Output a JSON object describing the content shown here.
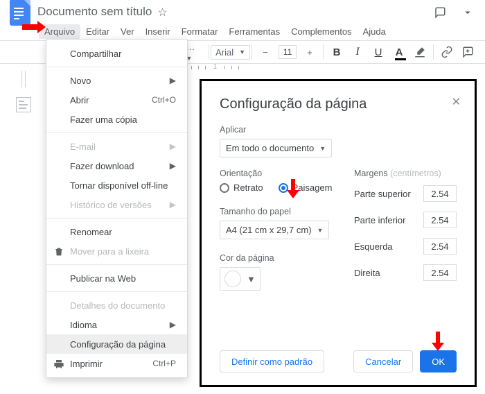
{
  "doc": {
    "title": "Documento sem título"
  },
  "top_icons": {
    "comments": "comments-icon",
    "share_caret": ""
  },
  "menubar": {
    "items": [
      "Arquivo",
      "Editar",
      "Ver",
      "Inserir",
      "Formatar",
      "Ferramentas",
      "Complementos",
      "Ajuda"
    ],
    "open_index": 0
  },
  "toolbar": {
    "font": "Arial",
    "size": "11",
    "minus": "−",
    "plus": "+",
    "bold": "B",
    "italic": "I",
    "underline": "U"
  },
  "ruler": {
    "first": 1
  },
  "dropdown": {
    "items": [
      {
        "label": "Compartilhar"
      },
      {
        "sep": true
      },
      {
        "label": "Novo",
        "submenu": true
      },
      {
        "label": "Abrir",
        "shortcut": "Ctrl+O"
      },
      {
        "label": "Fazer uma cópia"
      },
      {
        "sep": true
      },
      {
        "label": "E-mail",
        "submenu": true,
        "disabled": true
      },
      {
        "label": "Fazer download",
        "submenu": true
      },
      {
        "label": "Tornar disponível off-line"
      },
      {
        "label": "Histórico de versões",
        "submenu": true,
        "disabled": true
      },
      {
        "sep": true
      },
      {
        "label": "Renomear"
      },
      {
        "label": "Mover para a lixeira",
        "disabled": true,
        "icon": "trash"
      },
      {
        "sep": true
      },
      {
        "label": "Publicar na Web"
      },
      {
        "sep": true
      },
      {
        "label": "Detalhes do documento",
        "disabled": true
      },
      {
        "label": "Idioma",
        "submenu": true
      },
      {
        "label": "Configuração da página",
        "selected": true
      },
      {
        "label": "Imprimir",
        "shortcut": "Ctrl+P",
        "icon": "print"
      }
    ]
  },
  "dialog": {
    "title": "Configuração da página",
    "apply_label": "Aplicar",
    "apply_value": "Em todo o documento",
    "orientation_label": "Orientação",
    "portrait": "Retrato",
    "landscape": "Paisagem",
    "orientation_selected": "landscape",
    "paper_label": "Tamanho do papel",
    "paper_value": "A4 (21 cm x 29,7 cm)",
    "color_label": "Cor da página",
    "margins_label": "Margens",
    "margins_unit": "(centímetros)",
    "margins": {
      "top": {
        "label": "Parte superior",
        "value": "2.54"
      },
      "bottom": {
        "label": "Parte inferior",
        "value": "2.54"
      },
      "left": {
        "label": "Esquerda",
        "value": "2.54"
      },
      "right": {
        "label": "Direita",
        "value": "2.54"
      }
    },
    "set_default": "Definir como padrão",
    "cancel": "Cancelar",
    "ok": "OK"
  }
}
